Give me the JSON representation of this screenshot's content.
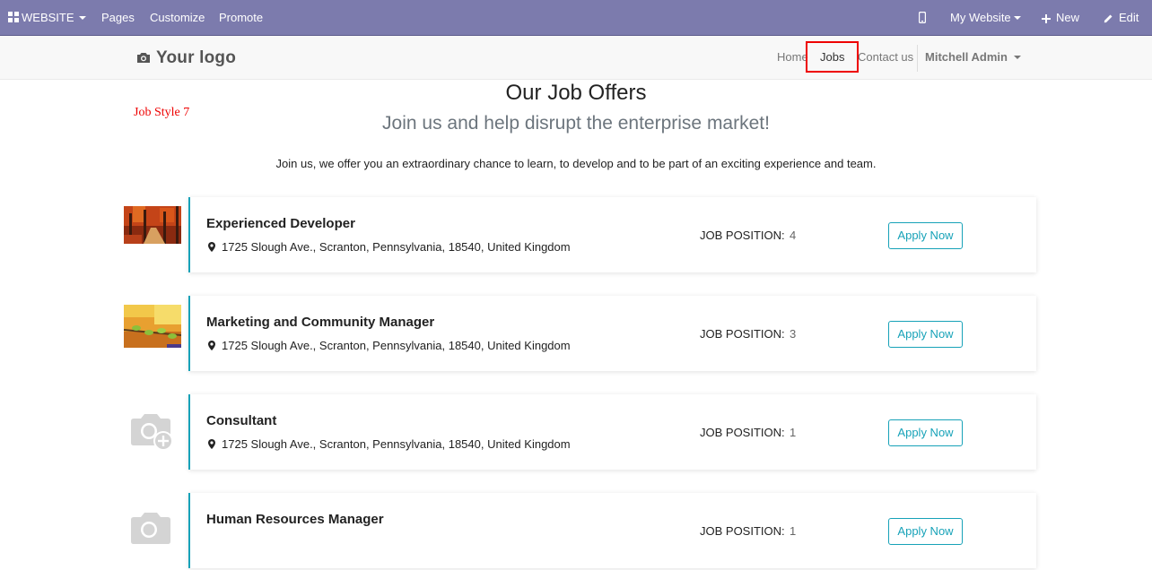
{
  "adminbar": {
    "website_label": "WEBSITE",
    "pages_label": "Pages",
    "customize_label": "Customize",
    "promote_label": "Promote",
    "mywebsite_label": "My Website",
    "new_label": "New",
    "edit_label": "Edit"
  },
  "header": {
    "logo_text": "Your logo",
    "nav": [
      "Home",
      "Jobs",
      "Contact us"
    ],
    "user": "Mitchell Admin"
  },
  "page": {
    "style_tag": "Job Style 7",
    "title": "Our Job Offers",
    "subtitle": "Join us and help disrupt the enterprise market!",
    "intro": "Join us, we offer you an extraordinary chance to learn, to develop and to be part of an exciting experience and team."
  },
  "jobs": [
    {
      "title": "Experienced Developer",
      "address": "1725 Slough Ave., Scranton, Pennsylvania, 18540, United Kingdom",
      "position_label": "JOB POSITION:",
      "position_count": "4",
      "apply_label": "Apply Now",
      "image": "autumn-forest"
    },
    {
      "title": "Marketing and Community Manager",
      "address": "1725 Slough Ave., Scranton, Pennsylvania, 18540, United Kingdom",
      "position_label": "JOB POSITION:",
      "position_count": "3",
      "apply_label": "Apply Now",
      "image": "branch-leaves"
    },
    {
      "title": "Consultant",
      "address": "1725 Slough Ave., Scranton, Pennsylvania, 18540, United Kingdom",
      "position_label": "JOB POSITION:",
      "position_count": "1",
      "apply_label": "Apply Now",
      "image": "camera-placeholder"
    },
    {
      "title": "Human Resources Manager",
      "address": "",
      "position_label": "JOB POSITION:",
      "position_count": "1",
      "apply_label": "Apply Now",
      "image": "camera-placeholder"
    }
  ],
  "colors": {
    "adminbar": "#7c7bad",
    "accent": "#17a2b8",
    "highlight": "#e00000"
  }
}
